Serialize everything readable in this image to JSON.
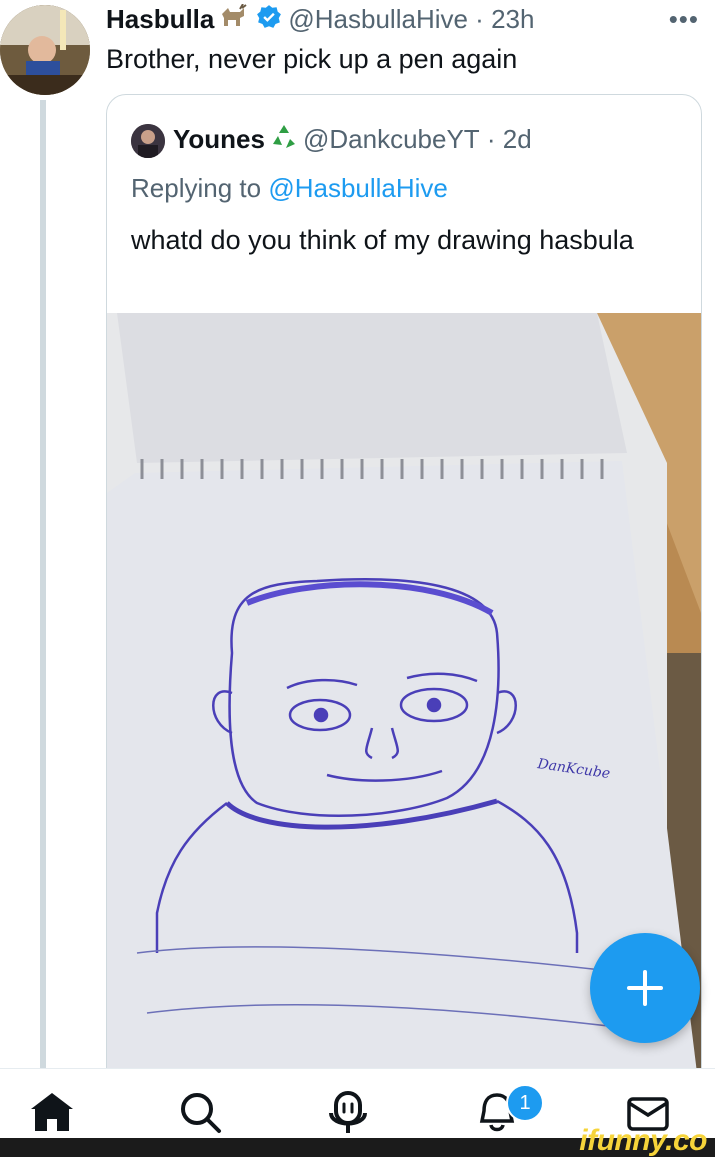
{
  "tweet": {
    "author_name": "Hasbulla",
    "author_emoji": "goat-emoji",
    "verified_icon": "verified-badge-icon",
    "handle": "@HasbullaHive",
    "separator": "·",
    "time": "23h",
    "more_icon": "more-options-icon",
    "text": "Brother, never pick up a pen again"
  },
  "quoted_tweet": {
    "author_name": "Younes",
    "author_emoji": "recycle-emoji",
    "handle": "@DankcubeYT",
    "separator": "·",
    "time": "2d",
    "replying_prefix": "Replying to ",
    "replying_to": "@HasbullaHive",
    "text": "whatd do you think of my drawing hasbula",
    "image_signature": "DanKcube"
  },
  "compose_button": {
    "icon": "plus-icon"
  },
  "tabbar": {
    "items": [
      {
        "name": "home",
        "icon": "home-icon"
      },
      {
        "name": "search",
        "icon": "search-icon"
      },
      {
        "name": "spaces",
        "icon": "spaces-icon"
      },
      {
        "name": "notifications",
        "icon": "bell-icon",
        "badge": "1"
      },
      {
        "name": "messages",
        "icon": "mail-icon"
      }
    ]
  },
  "watermark": "ifunny.co",
  "colors": {
    "accent": "#1d9bf0",
    "text": "#0f1419",
    "secondary": "#536471",
    "border": "#cfd9de",
    "watermark": "#f6d43a"
  }
}
